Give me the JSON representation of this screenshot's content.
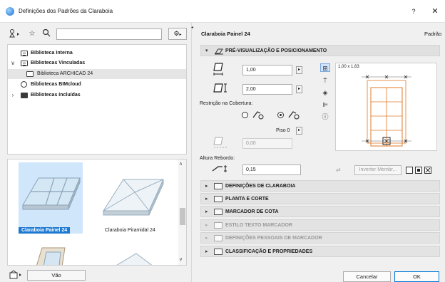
{
  "window": {
    "title": "Definições dos Padrões da Claraboia",
    "help_label": "?",
    "close_label": "✕"
  },
  "left": {
    "search": {
      "value": "",
      "placeholder": ""
    },
    "tree": [
      {
        "label": "Biblioteca Interna",
        "icon": "book-icon",
        "chevron": ""
      },
      {
        "label": "Bibliotecas Vinculadas",
        "icon": "book-icon",
        "chevron": "∨"
      },
      {
        "label": "Biblioteca ARCHICAD 24",
        "icon": "folder-icon",
        "chevron": ""
      },
      {
        "label": "Bibliotecas BIMcloud",
        "icon": "cloud-icon",
        "chevron": ""
      },
      {
        "label": "Bibliotecas Incluídas",
        "icon": "folder-icon",
        "chevron": "›"
      }
    ],
    "thumbnails": [
      {
        "label": "Claraboia Painel 24",
        "selected": true
      },
      {
        "label": "Claraboia Piramidal 24",
        "selected": false
      }
    ],
    "vao_label": "Vão"
  },
  "right": {
    "item_title": "Claraboia Painel 24",
    "item_standard": "Padrão",
    "preview_section": "PRÉ-VISUALIZAÇÃO E POSICIONAMENTO",
    "width_value": "1,00",
    "height_value": "2,00",
    "roof_constraint_label": "Restrição na Cobertura:",
    "floor_label": "Piso 0",
    "offset_value": "0,00",
    "curb_label": "Altura Rebordo:",
    "curb_value": "0,15",
    "dim_readout": "1,00 x 1,63",
    "invert_label": "Inverter Membr...",
    "sections": [
      {
        "label": "DEFINIÇÕES DE CLARABOIA",
        "disabled": false
      },
      {
        "label": "PLANTA E CORTE",
        "disabled": false
      },
      {
        "label": "MARCADOR DE COTA",
        "disabled": false
      },
      {
        "label": "ESTILO TEXTO MARCADOR",
        "disabled": true
      },
      {
        "label": "DEFINIÇÕES PESSOAIS DE MARCADOR",
        "disabled": true
      },
      {
        "label": "CLASSIFICAÇÃO E PROPRIEDADES",
        "disabled": false
      }
    ]
  },
  "footer": {
    "cancel_label": "Cancelar",
    "ok_label": "OK"
  },
  "colors": {
    "selection_blue": "#1f79d2",
    "accent_orange": "#e07a2a"
  }
}
